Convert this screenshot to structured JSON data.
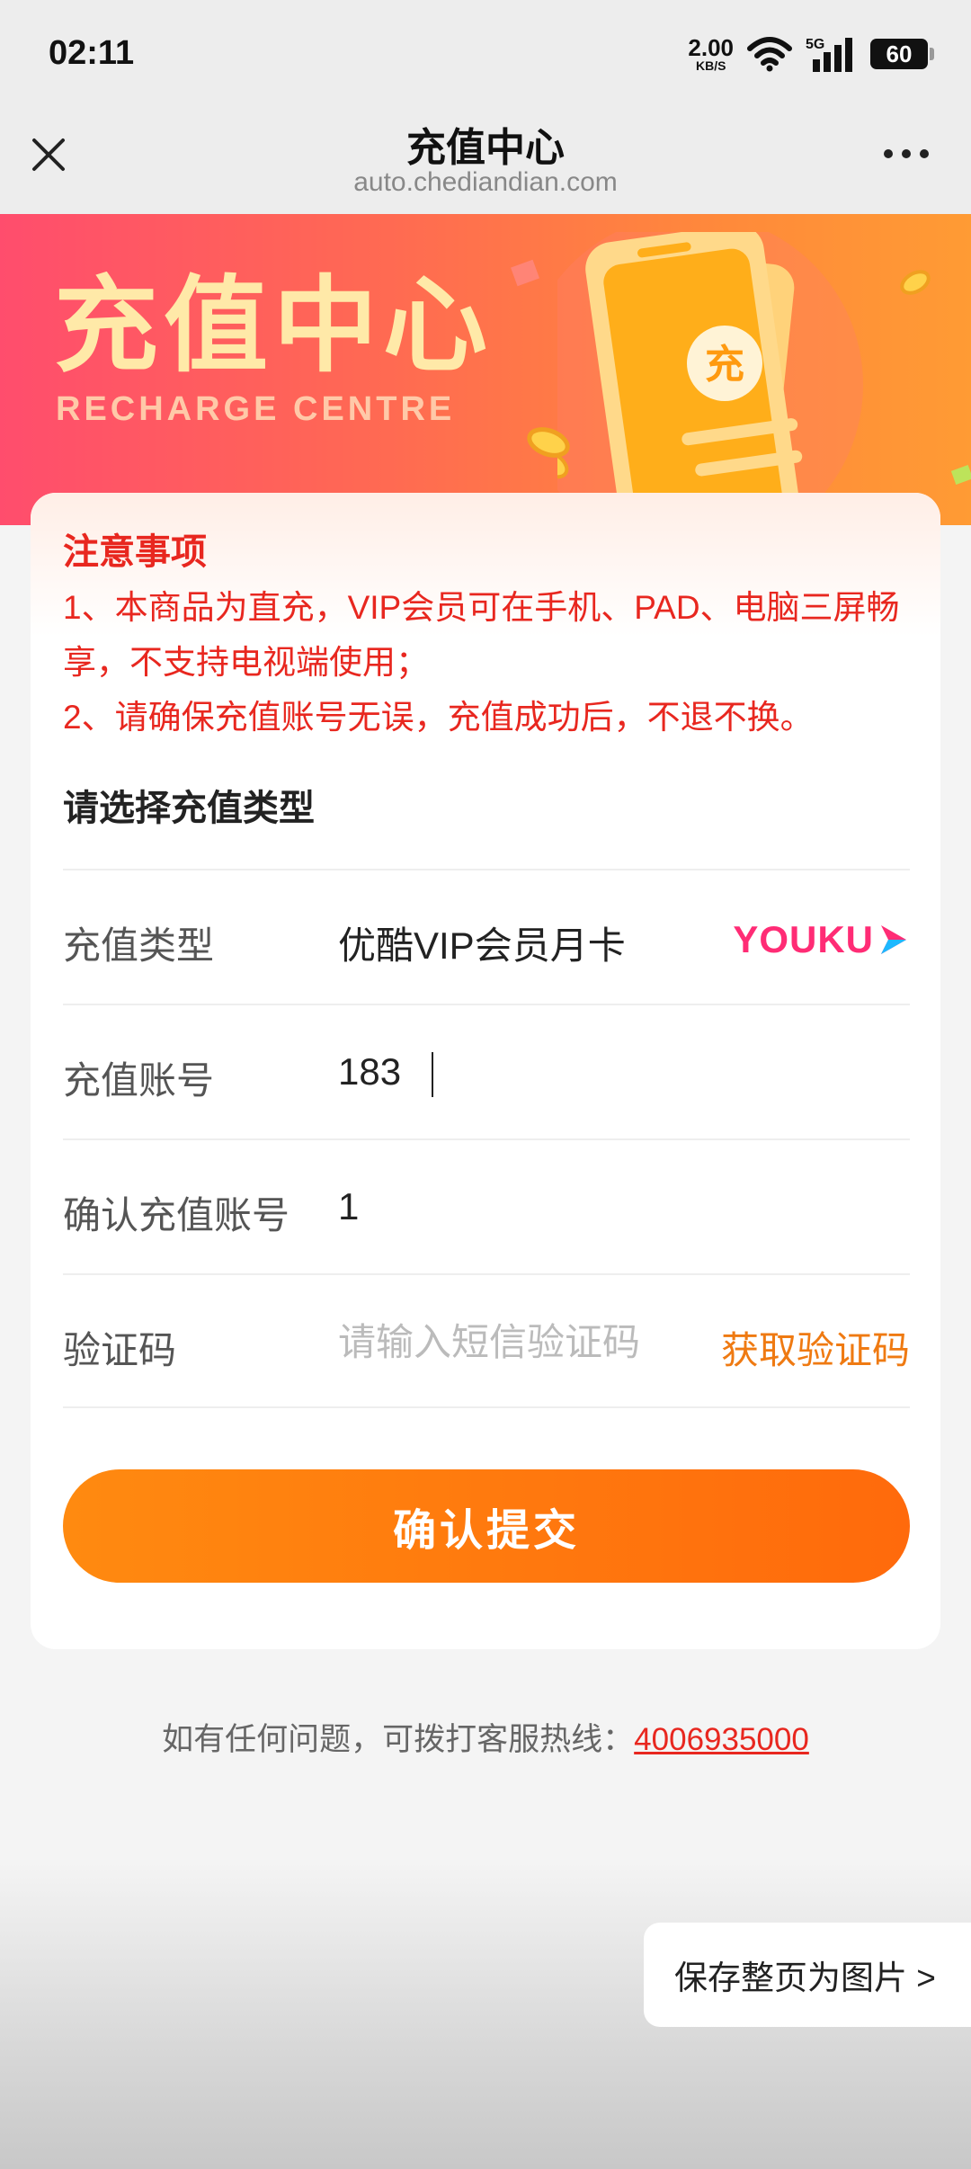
{
  "status_bar": {
    "time": "02:11",
    "net_speed_value": "2.00",
    "net_speed_unit": "KB/S",
    "network": "5G",
    "battery": "60"
  },
  "nav": {
    "title": "充值中心",
    "url": "auto.chediandian.com"
  },
  "banner": {
    "title": "充值中心",
    "subtitle": "RECHARGE CENTRE",
    "icon_char": "充"
  },
  "notice": {
    "title": "注意事项",
    "line1": "1、本商品为直充，VIP会员可在手机、PAD、电脑三屏畅享，不支持电视端使用；",
    "line2": "2、请确保充值账号无误，充值成功后，不退不换。"
  },
  "form": {
    "section_title": "请选择充值类型",
    "type_label": "充值类型",
    "type_value": "优酷VIP会员月卡",
    "brand": "YOUKU",
    "account_label": "充值账号",
    "account_value": "183",
    "confirm_label": "确认充值账号",
    "confirm_value": "1",
    "code_label": "验证码",
    "code_placeholder": "请输入短信验证码",
    "get_code": "获取验证码",
    "submit": "确认提交"
  },
  "footer": {
    "hotline_text": "如有任何问题，可拨打客服热线：",
    "hotline_number": "4006935000",
    "save_page": "保存整页为图片 >"
  },
  "colors": {
    "accent": "#ff7a10",
    "notice_red": "#e8271f",
    "youku_pink": "#ff2c75",
    "youku_blue": "#1db8ff"
  }
}
